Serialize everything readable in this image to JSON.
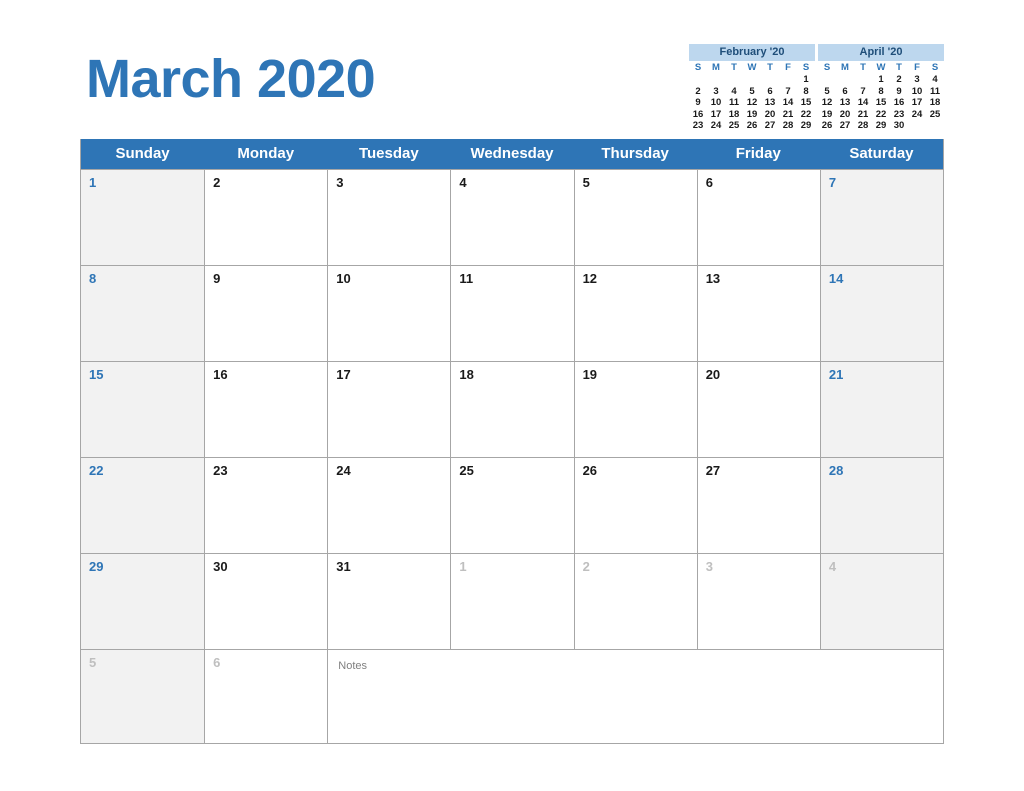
{
  "title": "March 2020",
  "mini_calendars": [
    {
      "id": "prev",
      "title": "February '20",
      "dow": [
        "S",
        "M",
        "T",
        "W",
        "T",
        "F",
        "S"
      ],
      "weeks": [
        [
          "",
          "",
          "",
          "",
          "",
          "",
          "1"
        ],
        [
          "2",
          "3",
          "4",
          "5",
          "6",
          "7",
          "8"
        ],
        [
          "9",
          "10",
          "11",
          "12",
          "13",
          "14",
          "15"
        ],
        [
          "16",
          "17",
          "18",
          "19",
          "20",
          "21",
          "22"
        ],
        [
          "23",
          "24",
          "25",
          "26",
          "27",
          "28",
          "29"
        ]
      ]
    },
    {
      "id": "next",
      "title": "April '20",
      "dow": [
        "S",
        "M",
        "T",
        "W",
        "T",
        "F",
        "S"
      ],
      "weeks": [
        [
          "",
          "",
          "",
          "1",
          "2",
          "3",
          "4"
        ],
        [
          "5",
          "6",
          "7",
          "8",
          "9",
          "10",
          "11"
        ],
        [
          "12",
          "13",
          "14",
          "15",
          "16",
          "17",
          "18"
        ],
        [
          "19",
          "20",
          "21",
          "22",
          "23",
          "24",
          "25"
        ],
        [
          "26",
          "27",
          "28",
          "29",
          "30",
          "",
          ""
        ]
      ]
    }
  ],
  "weekday_headers": [
    "Sunday",
    "Monday",
    "Tuesday",
    "Wednesday",
    "Thursday",
    "Friday",
    "Saturday"
  ],
  "weeks": [
    [
      {
        "n": "1",
        "weekend": true,
        "other": false
      },
      {
        "n": "2",
        "weekend": false,
        "other": false
      },
      {
        "n": "3",
        "weekend": false,
        "other": false
      },
      {
        "n": "4",
        "weekend": false,
        "other": false
      },
      {
        "n": "5",
        "weekend": false,
        "other": false
      },
      {
        "n": "6",
        "weekend": false,
        "other": false
      },
      {
        "n": "7",
        "weekend": true,
        "other": false
      }
    ],
    [
      {
        "n": "8",
        "weekend": true,
        "other": false
      },
      {
        "n": "9",
        "weekend": false,
        "other": false
      },
      {
        "n": "10",
        "weekend": false,
        "other": false
      },
      {
        "n": "11",
        "weekend": false,
        "other": false
      },
      {
        "n": "12",
        "weekend": false,
        "other": false
      },
      {
        "n": "13",
        "weekend": false,
        "other": false
      },
      {
        "n": "14",
        "weekend": true,
        "other": false
      }
    ],
    [
      {
        "n": "15",
        "weekend": true,
        "other": false
      },
      {
        "n": "16",
        "weekend": false,
        "other": false
      },
      {
        "n": "17",
        "weekend": false,
        "other": false
      },
      {
        "n": "18",
        "weekend": false,
        "other": false
      },
      {
        "n": "19",
        "weekend": false,
        "other": false
      },
      {
        "n": "20",
        "weekend": false,
        "other": false
      },
      {
        "n": "21",
        "weekend": true,
        "other": false
      }
    ],
    [
      {
        "n": "22",
        "weekend": true,
        "other": false
      },
      {
        "n": "23",
        "weekend": false,
        "other": false
      },
      {
        "n": "24",
        "weekend": false,
        "other": false
      },
      {
        "n": "25",
        "weekend": false,
        "other": false
      },
      {
        "n": "26",
        "weekend": false,
        "other": false
      },
      {
        "n": "27",
        "weekend": false,
        "other": false
      },
      {
        "n": "28",
        "weekend": true,
        "other": false
      }
    ],
    [
      {
        "n": "29",
        "weekend": true,
        "other": false
      },
      {
        "n": "30",
        "weekend": false,
        "other": false
      },
      {
        "n": "31",
        "weekend": false,
        "other": false
      },
      {
        "n": "1",
        "weekend": false,
        "other": true
      },
      {
        "n": "2",
        "weekend": false,
        "other": true
      },
      {
        "n": "3",
        "weekend": false,
        "other": true
      },
      {
        "n": "4",
        "weekend": true,
        "other": true
      }
    ]
  ],
  "notes_row": {
    "cells": [
      {
        "n": "5",
        "weekend": true,
        "other": true
      },
      {
        "n": "6",
        "weekend": false,
        "other": true
      }
    ],
    "notes_label": "Notes"
  },
  "colors": {
    "accent_blue": "#2e75b6",
    "mini_header_blue": "#bdd7ee",
    "mini_title_text": "#1f4e79",
    "weekend_shade": "#f2f2f2",
    "grid_line": "#a6a6a6",
    "other_month_text": "#bfbfbf",
    "notes_text": "#808080"
  }
}
